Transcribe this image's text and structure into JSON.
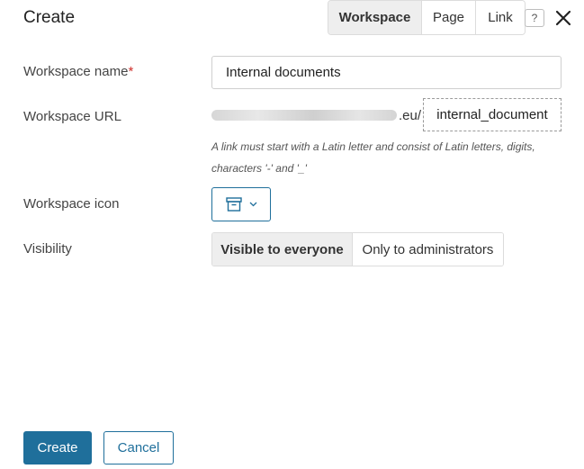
{
  "dialog": {
    "title": "Create",
    "type_tabs": [
      {
        "label": "Workspace",
        "active": true
      },
      {
        "label": "Page",
        "active": false
      },
      {
        "label": "Link",
        "active": false
      }
    ],
    "help_label": "?"
  },
  "form": {
    "name": {
      "label": "Workspace name",
      "required_mark": "*",
      "value": "Internal documents"
    },
    "url": {
      "label": "Workspace URL",
      "prefix_suffix": ".eu/",
      "slug": "internal_document",
      "hint": "A link must start with a Latin letter and consist of Latin letters, digits, characters '-' and '_'"
    },
    "icon": {
      "label": "Workspace icon",
      "selected_icon": "archive-box-icon"
    },
    "visibility": {
      "label": "Visibility",
      "options": [
        {
          "label": "Visible to everyone",
          "active": true
        },
        {
          "label": "Only to administrators",
          "active": false
        }
      ]
    }
  },
  "footer": {
    "create_label": "Create",
    "cancel_label": "Cancel"
  },
  "colors": {
    "accent": "#1f6f9b",
    "required": "#d0312d",
    "active_segment_bg": "#eeeeee"
  }
}
